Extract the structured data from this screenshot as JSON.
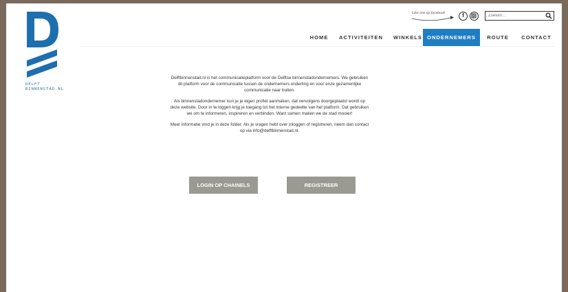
{
  "logo": {
    "text_line1": "DELFT",
    "text_line2": "BINNENSTAD.NL",
    "color": "#1e6fae"
  },
  "header": {
    "facebook_promo": "Like ons op facebook",
    "social_icons": [
      "facebook-icon",
      "instagram-icon"
    ],
    "search": {
      "placeholder": "Zoeken...",
      "value": "",
      "icon": "search-icon"
    }
  },
  "nav": {
    "items": [
      {
        "label": "HOME",
        "active": false
      },
      {
        "label": "ACTIVITEITEN",
        "active": false
      },
      {
        "label": "WINKELS",
        "active": false
      },
      {
        "label": "ONDERNEMERS",
        "active": true
      },
      {
        "label": "ROUTE",
        "active": false
      },
      {
        "label": "CONTACT",
        "active": false
      }
    ],
    "active_color": "#1f7dc4"
  },
  "main": {
    "paragraphs": [
      "Delftbinnenstad.nl is het communicatieplatform voor de Delftse binnenstadondernemers. We gebruiken dit platform voor de communicatie tussen de ondernemers onderling en voor enze gezamenlijke communicatie naar buiten.",
      "Als binnenstadondernemer kun je je eigen profiel aanmaken, dat vervolgens doorgeplaatst wordt op deze website. Door in te loggen krijg je toegang tot het interne gedeelte van het platform. Dat gebruiken we om te informeren, inspireren en verbinden. Want samen maken we de stad mooier!",
      "Meer informatie vind je in deze folder.  Als je vragen hebt over inloggen of registreren, neem dan contact op via info@delftbinnenstad.nl."
    ],
    "login_button": "LOGIN OP CHAINELS",
    "register_button": "REGISTREER",
    "button_color": "#9a9a90"
  }
}
